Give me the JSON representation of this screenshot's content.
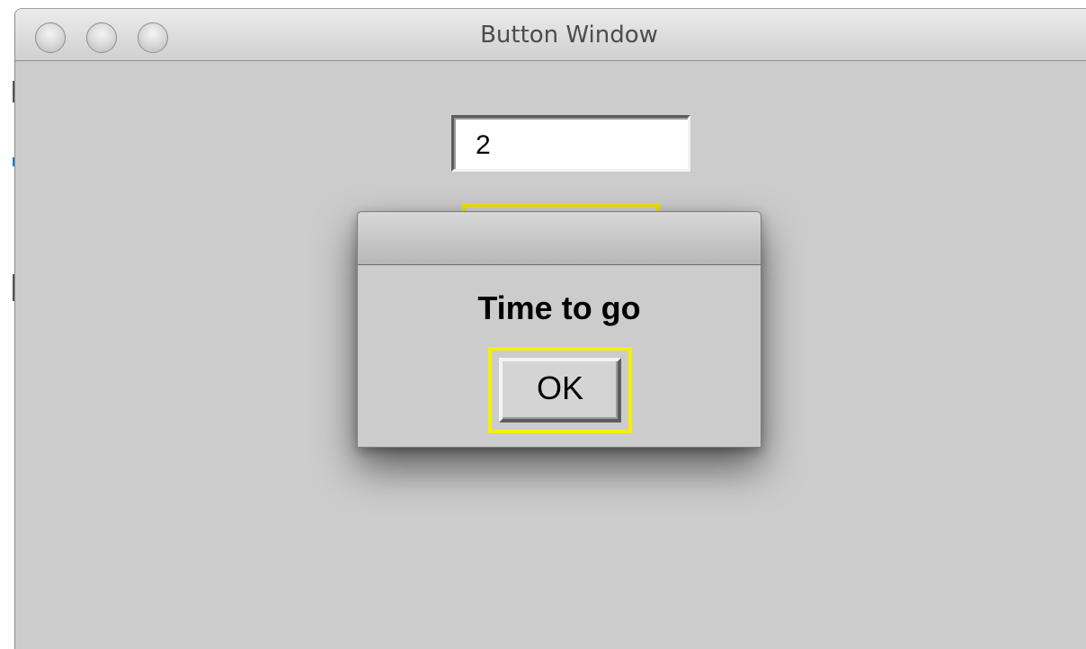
{
  "window": {
    "title": "Button Window"
  },
  "text_field": {
    "value": "2"
  },
  "dialog": {
    "title": "",
    "message": "Time to go",
    "ok_label": "OK"
  },
  "colors": {
    "window_background": "#cccccc",
    "focus_ring": "#f5f000",
    "text": "#000000"
  },
  "icons": {
    "traffic_lights": [
      "close-icon",
      "minimize-icon",
      "zoom-icon"
    ],
    "resize": "resize-grip-icon"
  }
}
